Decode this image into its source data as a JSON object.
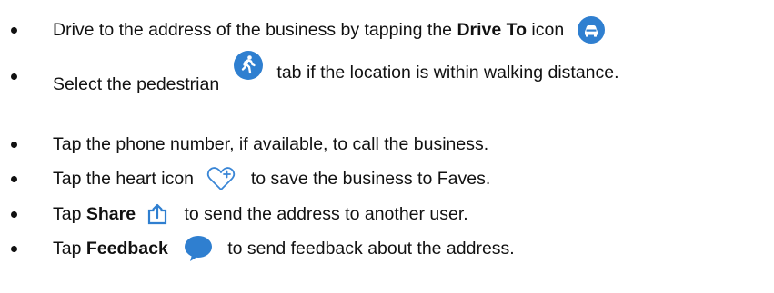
{
  "instructions": [
    {
      "pre": "Drive to the address of the business by tapping the ",
      "bold": "Drive To",
      "post": " icon",
      "icon": "car-icon"
    },
    {
      "pre": "Select the pedestrian ",
      "post": " tab if the location is within walking distance.",
      "icon": "pedestrian-icon"
    },
    {
      "pre": "Tap the phone number, if available, to call the business."
    },
    {
      "pre": "Tap the heart icon ",
      "post": " to save the business to Faves.",
      "icon": "heart-plus-icon"
    },
    {
      "pre": "Tap ",
      "bold": "Share",
      "post": " to send the address to another user.",
      "icon": "share-icon"
    },
    {
      "pre": "Tap ",
      "bold": "Feedback",
      "post": " to send feedback about the address.",
      "icon": "feedback-icon"
    }
  ],
  "colors": {
    "icon_blue": "#2f7fd0",
    "heart_blue": "#3a86d6",
    "text": "#111111"
  }
}
